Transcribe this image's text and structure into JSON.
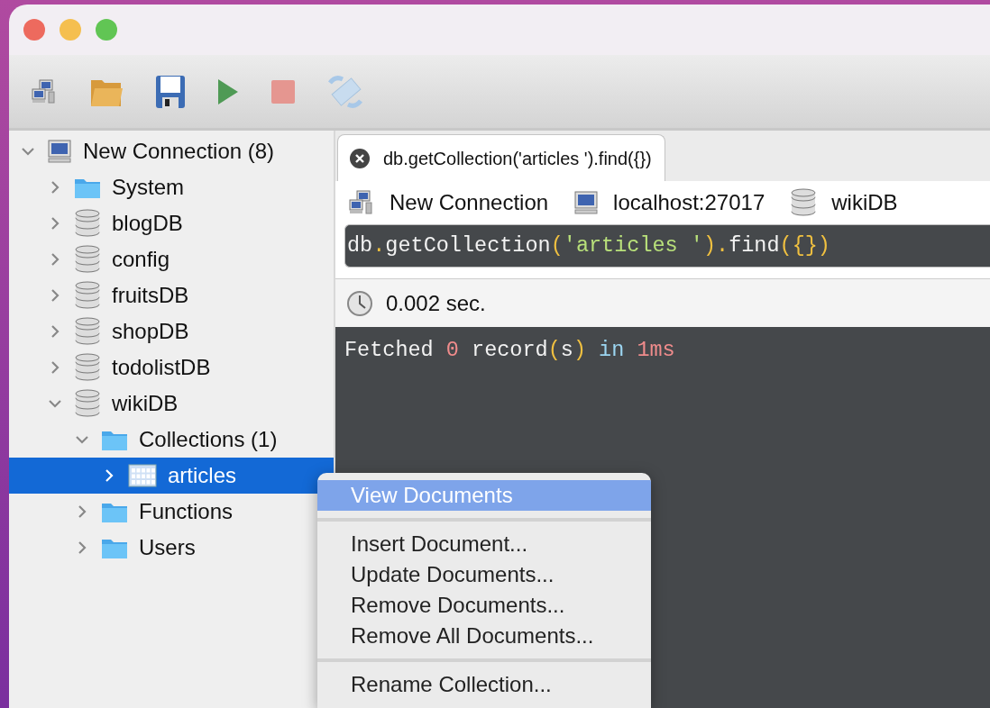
{
  "toolbar": [
    {
      "kind": "connect"
    },
    {
      "kind": "open"
    },
    {
      "kind": "save"
    },
    {
      "kind": "run"
    },
    {
      "kind": "stop"
    },
    {
      "kind": "refresh"
    }
  ],
  "tree": [
    {
      "label": "New Connection (8)",
      "kind": "computer",
      "expanded": true,
      "selected": false,
      "children": [
        {
          "label": "System",
          "kind": "folder",
          "expanded": false,
          "selected": false
        },
        {
          "label": "blogDB",
          "kind": "database",
          "expanded": false,
          "selected": false
        },
        {
          "label": "config",
          "kind": "database",
          "expanded": false,
          "selected": false
        },
        {
          "label": "fruitsDB",
          "kind": "database",
          "expanded": false,
          "selected": false
        },
        {
          "label": "shopDB",
          "kind": "database",
          "expanded": false,
          "selected": false
        },
        {
          "label": "todolistDB",
          "kind": "database",
          "expanded": false,
          "selected": false
        },
        {
          "label": "wikiDB",
          "kind": "database",
          "expanded": true,
          "selected": false,
          "children": [
            {
              "label": "Collections (1)",
              "kind": "folder",
              "expanded": true,
              "selected": false,
              "children": [
                {
                  "label": "articles",
                  "kind": "collection",
                  "expanded": false,
                  "selected": true
                }
              ]
            },
            {
              "label": "Functions",
              "kind": "folder",
              "expanded": false,
              "selected": false
            },
            {
              "label": "Users",
              "kind": "folder",
              "expanded": false,
              "selected": false
            }
          ]
        }
      ]
    }
  ],
  "tabs": [
    {
      "label": "db.getCollection('articles ').find({})",
      "selected": true
    }
  ],
  "info": [
    {
      "kind": "connect",
      "label": "New Connection"
    },
    {
      "kind": "computer",
      "label": "localhost:27017"
    },
    {
      "kind": "database",
      "label": "wikiDB"
    }
  ],
  "query": [
    {
      "kind": "plain",
      "text": "db"
    },
    {
      "kind": "punct",
      "text": "."
    },
    {
      "kind": "plain",
      "text": "getCollection"
    },
    {
      "kind": "punct",
      "text": "("
    },
    {
      "kind": "string",
      "text": "'articles '"
    },
    {
      "kind": "punct",
      "text": ")."
    },
    {
      "kind": "plain",
      "text": "find"
    },
    {
      "kind": "punct",
      "text": "({})"
    }
  ],
  "time": "0.002 sec.",
  "output": [
    {
      "kind": "plain",
      "text": "Fetched "
    },
    {
      "kind": "number",
      "text": "0"
    },
    {
      "kind": "plain",
      "text": " record"
    },
    {
      "kind": "punct",
      "text": "("
    },
    {
      "kind": "plain",
      "text": "s"
    },
    {
      "kind": "punct",
      "text": ")"
    },
    {
      "kind": "keyword",
      "text": " in"
    },
    {
      "kind": "number",
      "text": " 1ms"
    }
  ],
  "context_menu": [
    [
      {
        "label": "View Documents",
        "selected": true
      }
    ],
    [
      {
        "label": "Insert Document...",
        "selected": false
      },
      {
        "label": "Update Documents...",
        "selected": false
      },
      {
        "label": "Remove Documents...",
        "selected": false
      },
      {
        "label": "Remove All Documents...",
        "selected": false
      }
    ],
    [
      {
        "label": "Rename Collection...",
        "selected": false
      }
    ]
  ]
}
